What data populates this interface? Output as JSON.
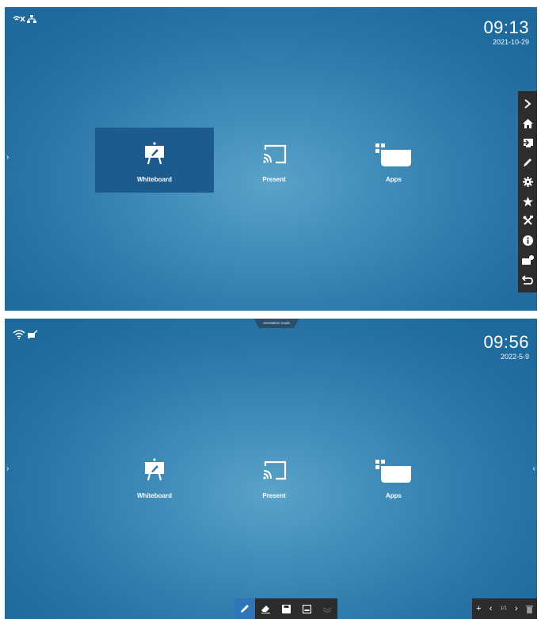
{
  "screen1": {
    "clock": {
      "time": "09:13",
      "date": "2021-10-29"
    },
    "tiles": [
      {
        "label": "Whiteboard",
        "icon": "whiteboard-icon",
        "selected": true
      },
      {
        "label": "Present",
        "icon": "cast-icon",
        "selected": false
      },
      {
        "label": "Apps",
        "icon": "apps-icon",
        "selected": false
      }
    ],
    "sidebar": [
      "collapse-icon",
      "home-icon",
      "input-source-icon",
      "annotate-pen-icon",
      "settings-gear-icon",
      "favorite-star-icon",
      "tools-icon",
      "info-icon",
      "camera-icon",
      "back-icon"
    ]
  },
  "screen2": {
    "clock": {
      "time": "09:56",
      "date": "2022-5-9"
    },
    "mode_tag": "Annotation mode",
    "tiles": [
      {
        "label": "Whiteboard",
        "icon": "whiteboard-icon"
      },
      {
        "label": "Present",
        "icon": "cast-icon"
      },
      {
        "label": "Apps",
        "icon": "apps-icon"
      }
    ],
    "toolbar": [
      "pen-icon",
      "eraser-icon",
      "save-icon",
      "minimize-icon",
      "layers-icon"
    ],
    "pagebar": {
      "page": "1/1"
    }
  },
  "colors": {
    "background": "#2a76a8",
    "selected_tile": "#1d5a8e",
    "panel": "#2d2d2d",
    "active_tool": "#2f74b8"
  }
}
